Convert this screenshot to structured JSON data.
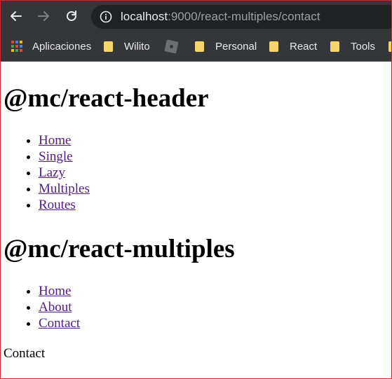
{
  "browser": {
    "url_host": "localhost",
    "url_path": ":9000/react-multiples/contact",
    "icons": {
      "back": "back-arrow-icon",
      "forward": "forward-arrow-icon",
      "reload": "reload-icon",
      "info": "info-icon",
      "apps": "apps-grid-icon",
      "folder": "folder-icon"
    },
    "bookmarks": [
      {
        "label": "Aplicaciones",
        "icon": "apps-grid-icon"
      },
      {
        "label": "Wilito",
        "icon": "folder-icon"
      },
      {
        "label": "",
        "icon": "extension-icon"
      },
      {
        "label": "Personal",
        "icon": "folder-icon"
      },
      {
        "label": "React",
        "icon": "folder-icon"
      },
      {
        "label": "Tools",
        "icon": "folder-icon"
      }
    ],
    "colors": {
      "toolbar": "#35363a",
      "omnibox": "#202124",
      "folder": "#f6d56b",
      "link": "#551a8b",
      "frame_border": "#c8282b"
    }
  },
  "page": {
    "header_title": "@mc/react-header",
    "header_nav": [
      "Home",
      "Single",
      "Lazy",
      "Multiples",
      "Routes"
    ],
    "multiples_title": "@mc/react-multiples",
    "multiples_nav": [
      "Home",
      "About",
      "Contact"
    ],
    "body_text": "Contact"
  }
}
